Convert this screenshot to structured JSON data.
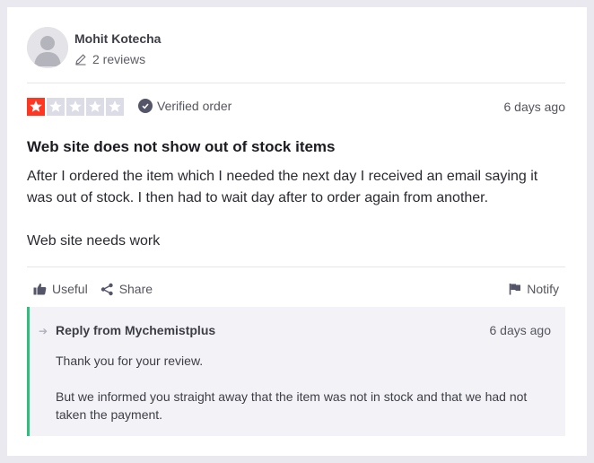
{
  "reviewer": {
    "name": "Mohit Kotecha",
    "reviews_count": "2 reviews"
  },
  "review": {
    "rating": 1,
    "rating_max": 5,
    "verified_label": "Verified order",
    "date": "6 days ago",
    "title": "Web site does not show out of stock items",
    "paragraphs": [
      "After I ordered the item which I needed the next day I received an email saying it was out of stock. I then had to wait day after to order again from another.",
      "Web site needs work"
    ]
  },
  "actions": {
    "useful_label": "Useful",
    "share_label": "Share",
    "notify_label": "Notify"
  },
  "reply": {
    "from": "Reply from Mychemistplus",
    "date": "6 days ago",
    "paragraphs": [
      "Thank you for your review.",
      "But we informed you straight away that the item was not in stock and that we had not taken the payment."
    ]
  },
  "colors": {
    "star_filled": "#ff3722",
    "star_empty": "#dcdce6",
    "reply_accent": "#2ebf7f"
  }
}
